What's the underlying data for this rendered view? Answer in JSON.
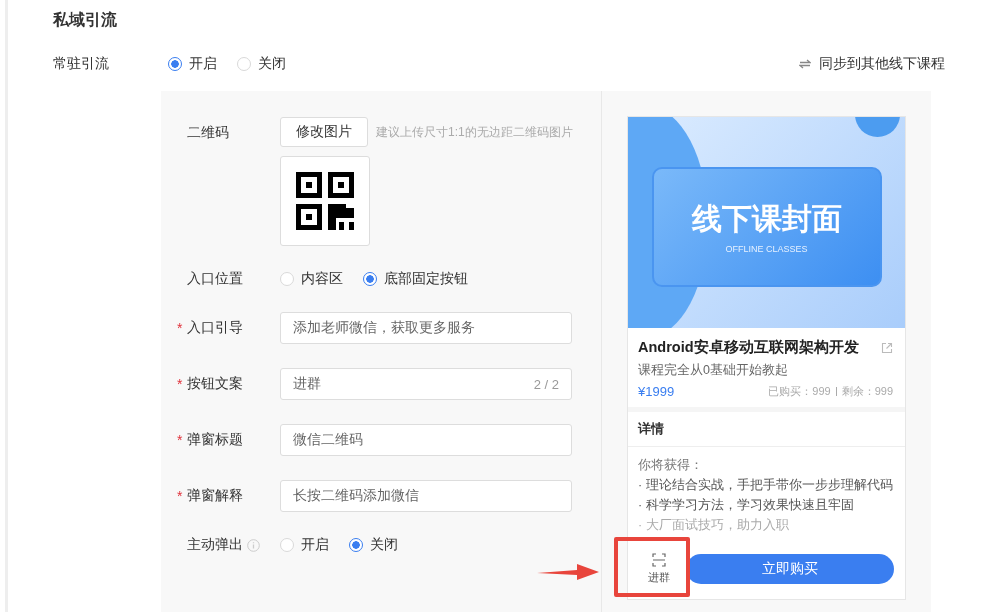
{
  "section_title": "私域引流",
  "resident": {
    "label": "常驻引流",
    "options": [
      {
        "label": "开启",
        "selected": true
      },
      {
        "label": "关闭",
        "selected": false
      }
    ]
  },
  "sync_link": "同步到其他线下课程",
  "form": {
    "qr": {
      "label": "二维码",
      "button": "修改图片",
      "hint": "建议上传尺寸1:1的无边距二维码图片"
    },
    "entry_position": {
      "label": "入口位置",
      "options": [
        {
          "label": "内容区",
          "selected": false
        },
        {
          "label": "底部固定按钮",
          "selected": true
        }
      ]
    },
    "required_sign": "*",
    "fields": [
      {
        "label": "入口引导",
        "required": true,
        "value": "添加老师微信，获取更多服务"
      },
      {
        "label": "按钮文案",
        "required": true,
        "value": "进群",
        "count": "2 / 2"
      },
      {
        "label": "弹窗标题",
        "required": true,
        "value": "微信二维码"
      },
      {
        "label": "弹窗解释",
        "required": true,
        "value": "长按二维码添加微信"
      }
    ],
    "auto_popup": {
      "label": "主动弹出",
      "options": [
        {
          "label": "开启",
          "selected": false
        },
        {
          "label": "关闭",
          "selected": true
        }
      ]
    }
  },
  "preview": {
    "cover_title": "线下课封面",
    "cover_subtitle": "OFFLINE CLASSES",
    "course_title": "Android安卓移动互联网架构开发",
    "subtitle": "课程完全从0基础开始教起",
    "price": "¥1999",
    "sold": "已购买：999",
    "remaining": "剩余：999",
    "details_heading": "详情",
    "details_intro": "你将获得：",
    "details_items": [
      "· 理论结合实战，手把手带你一步步理解代码",
      "· 科学学习方法，学习效果快速且牢固",
      "· 大厂面试技巧，助力入职"
    ],
    "group_button": "进群",
    "buy_button": "立即购买"
  }
}
